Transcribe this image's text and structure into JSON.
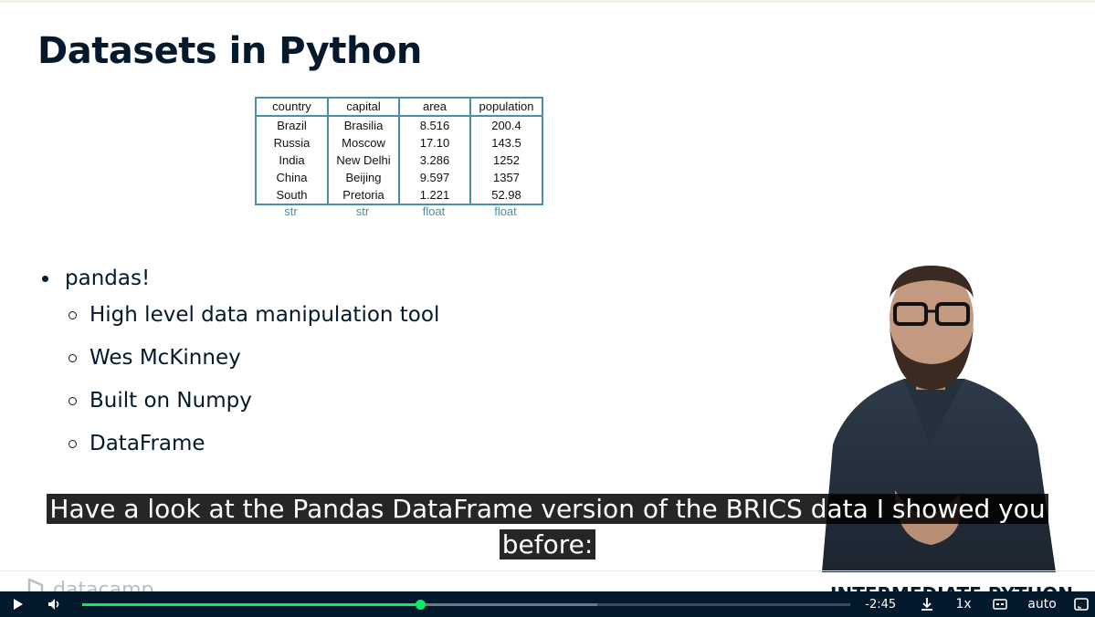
{
  "slide": {
    "title": "Datasets in Python",
    "table": {
      "headers": [
        "country",
        "capital",
        "area",
        "population"
      ],
      "rows": [
        [
          "Brazil",
          "Brasilia",
          "8.516",
          "200.4"
        ],
        [
          "Russia",
          "Moscow",
          "17.10",
          "143.5"
        ],
        [
          "India",
          "New Delhi",
          "3.286",
          "1252"
        ],
        [
          "China",
          "Beijing",
          "9.597",
          "1357"
        ],
        [
          "South",
          "Pretoria",
          "1.221",
          "52.98"
        ]
      ],
      "types": [
        "str",
        "str",
        "float",
        "float"
      ]
    },
    "bullets": {
      "main": "pandas!",
      "subs": [
        "High level data manipulation tool",
        "Wes McKinney",
        "Built on Numpy",
        "DataFrame"
      ]
    },
    "brand": "datacamp",
    "course": "INTERMEDIATE PYTHON"
  },
  "caption": {
    "line1": "Have a look at the Pandas DataFrame version of the BRICS data I showed you",
    "line2": "before:"
  },
  "player": {
    "time_remaining": "-2:45",
    "speed": "1x",
    "quality": "auto",
    "progress_fraction": 0.44,
    "buffered_fraction": 0.67,
    "icons": [
      "play-icon",
      "volume-icon",
      "download-icon",
      "captions-icon",
      "fullscreen-icon"
    ]
  },
  "colors": {
    "navy": "#05192d",
    "green": "#03ef62",
    "table_border": "#4a8fa6"
  }
}
